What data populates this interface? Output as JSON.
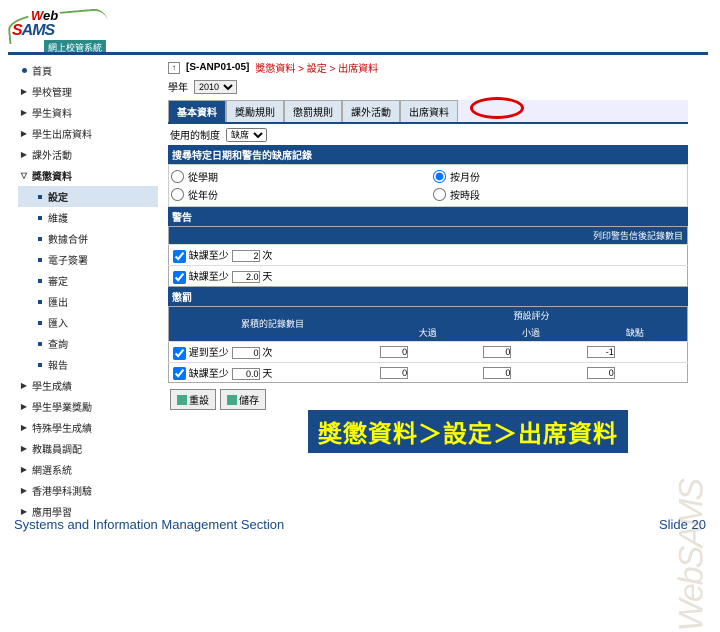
{
  "logo": {
    "web_w": "W",
    "web_rest": "eb",
    "sams_s": "S",
    "sams_rest": "AMS",
    "cn": "網上校管系統"
  },
  "nav": [
    {
      "t": "dot",
      "label": "首頁"
    },
    {
      "t": "tri",
      "label": "學校管理"
    },
    {
      "t": "tri",
      "label": "學生資料"
    },
    {
      "t": "tri",
      "label": "學生出席資料"
    },
    {
      "t": "tri",
      "label": "課外活動"
    },
    {
      "t": "down",
      "label": "獎懲資料",
      "cls": "bg"
    },
    {
      "t": "sub",
      "label": "設定",
      "active": true
    },
    {
      "t": "sub",
      "label": "維護"
    },
    {
      "t": "sub",
      "label": "數據合併"
    },
    {
      "t": "sub",
      "label": "電子簽署"
    },
    {
      "t": "sub",
      "label": "審定"
    },
    {
      "t": "sub",
      "label": "匯出"
    },
    {
      "t": "sub",
      "label": "匯入"
    },
    {
      "t": "sub",
      "label": "查詢"
    },
    {
      "t": "sub",
      "label": "報告"
    },
    {
      "t": "tri",
      "label": "學生成績"
    },
    {
      "t": "tri",
      "label": "學生學業獎勵"
    },
    {
      "t": "tri",
      "label": "特殊學生成績"
    },
    {
      "t": "tri",
      "label": "教職員調配"
    },
    {
      "t": "tri",
      "label": "網選系統"
    },
    {
      "t": "tri",
      "label": "香港學科測驗"
    },
    {
      "t": "tri",
      "label": "應用學習"
    }
  ],
  "main": {
    "bc_code": "[S-ANP01-05]",
    "bc_path": "獎懲資料 > 設定 > 出席資料",
    "year_label": "學年",
    "year_value": "2010",
    "tabs": [
      "基本資料",
      "獎勵規則",
      "懲罰規則",
      "課外活動",
      "出席資料"
    ],
    "active_tab": 0,
    "sect1_label": "使用的制度",
    "sect1_value": "缺席",
    "bar1": "搜尋特定日期和警告的缺席記錄",
    "radios": [
      {
        "label": "從學期",
        "val": false
      },
      {
        "label": "按月份",
        "val": true
      },
      {
        "label": "從年份",
        "val": false
      },
      {
        "label": "按時段",
        "val": false
      }
    ],
    "bar_warn": "警告",
    "warn_hdr": "列印警告信後記錄數目",
    "warn_rows": [
      {
        "chk": true,
        "label": "缺課至少",
        "v": "2",
        "u": "次"
      },
      {
        "chk": true,
        "label": "缺課至少",
        "v": "2.0",
        "u": "天"
      }
    ],
    "bar_pun": "懲罰",
    "pun_hdrs": [
      "累積的記錄數目",
      "預設評分"
    ],
    "pun_sub": [
      "大過",
      "小過",
      "缺點"
    ],
    "pun_rows": [
      {
        "chk": true,
        "label": "遲到至少",
        "v": "0",
        "u": "次",
        "a": "0",
        "b": "0",
        "c": "-1"
      },
      {
        "chk": true,
        "label": "缺課至少",
        "v": "0.0",
        "u": "天",
        "a": "0",
        "b": "0",
        "c": "0"
      }
    ],
    "btns": [
      {
        "icon": "back",
        "label": "重設"
      },
      {
        "icon": "save",
        "label": "儲存"
      }
    ]
  },
  "banner": "獎懲資料＞設定＞出席資料",
  "watermark": "WebSAMS",
  "footer": {
    "left": "Systems and Information Management Section",
    "right_label": "Slide",
    "right_num": "20"
  }
}
